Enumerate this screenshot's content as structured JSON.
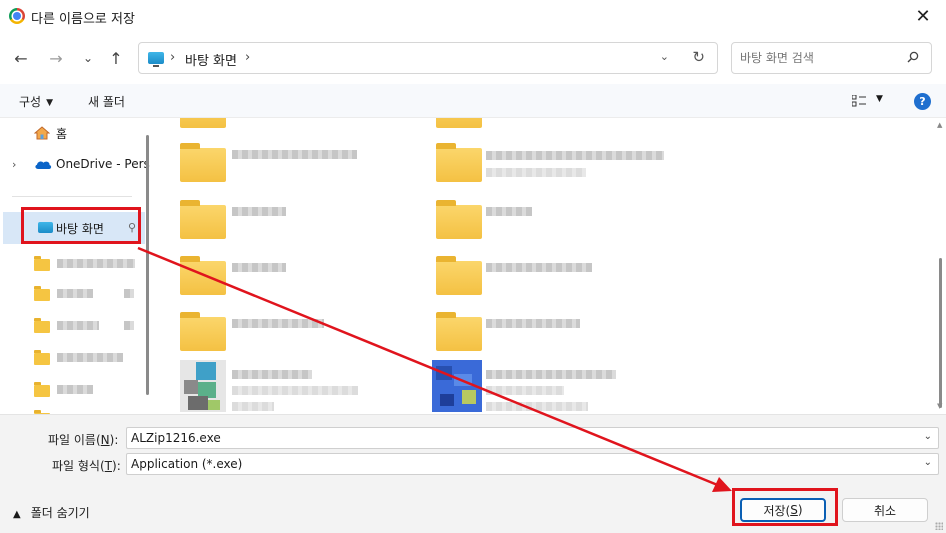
{
  "window": {
    "title": "다른 이름으로 저장",
    "close_symbol": "✕"
  },
  "nav": {
    "back_symbol": "←",
    "forward_symbol": "→",
    "recent_symbol": "⌄",
    "up_symbol": "↑",
    "path": [
      "바탕 화면"
    ],
    "path_sep": "›",
    "dropdown_symbol": "⌄",
    "refresh_symbol": "↻",
    "search_placeholder": "바탕 화면 검색"
  },
  "command_bar": {
    "organize": "구성",
    "new_folder": "새 폴더",
    "help": "?"
  },
  "sidebar": {
    "home": "홈",
    "onedrive": "OneDrive - Pers",
    "desktop": "바탕 화면",
    "expander": "›",
    "pin_symbol": "📌"
  },
  "form": {
    "filename_label": "파일 이름(",
    "filename_key": "N",
    "filename_label_end": "):",
    "filename_value": "ALZip1216.exe",
    "filetype_label": "파일 형식(",
    "filetype_key": "T",
    "filetype_label_end": "):",
    "filetype_value": "Application (*.exe)",
    "hide_folders": "폴더 숨기기",
    "save_label": "저장(",
    "save_key": "S",
    "save_end": ")",
    "cancel_label": "취소"
  },
  "colors": {
    "highlight": "#e0141d",
    "accent": "#0a5fb4",
    "folder": "#f5c542"
  }
}
